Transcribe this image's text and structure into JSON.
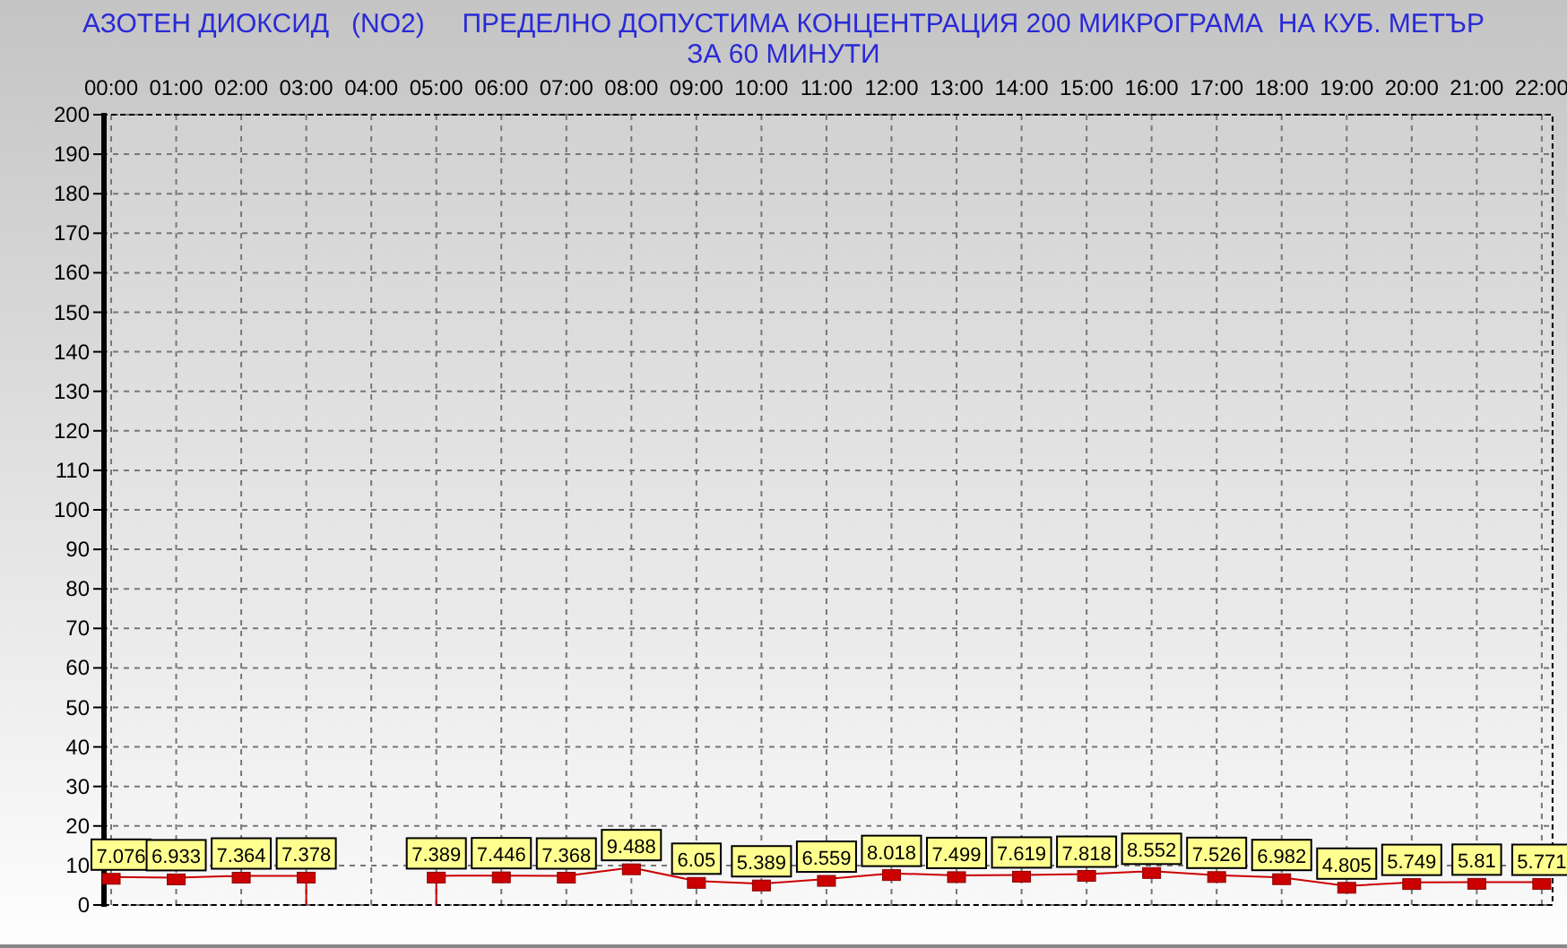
{
  "chart_data": {
    "type": "line",
    "title": "АЗОТЕН ДИОКСИД   (NO2)     ПРЕДЕЛНО ДОПУСТИМА КОНЦЕНТРАЦИЯ 200 МИКРОГРАМА  НА КУБ. МЕТЪР\nЗА 60 МИНУТИ",
    "categories": [
      "00:00",
      "01:00",
      "02:00",
      "03:00",
      "04:00",
      "05:00",
      "06:00",
      "07:00",
      "08:00",
      "09:00",
      "10:00",
      "11:00",
      "12:00",
      "13:00",
      "14:00",
      "15:00",
      "16:00",
      "17:00",
      "18:00",
      "19:00",
      "20:00",
      "21:00",
      "22:00"
    ],
    "series": [
      {
        "color": "#cc0000",
        "marker": "square",
        "values": [
          7.076,
          6.933,
          7.364,
          7.378,
          null,
          7.389,
          7.446,
          7.368,
          9.488,
          6.05,
          5.389,
          6.559,
          8.018,
          7.499,
          7.619,
          7.818,
          8.552,
          7.526,
          6.982,
          4.805,
          5.749,
          5.81,
          5.771
        ]
      }
    ],
    "data_labels": true,
    "grid": true,
    "ylim": [
      0,
      200
    ],
    "yticks": [
      0,
      10,
      20,
      30,
      40,
      50,
      60,
      70,
      80,
      90,
      100,
      110,
      120,
      130,
      140,
      150,
      160,
      170,
      180,
      190,
      200
    ]
  }
}
